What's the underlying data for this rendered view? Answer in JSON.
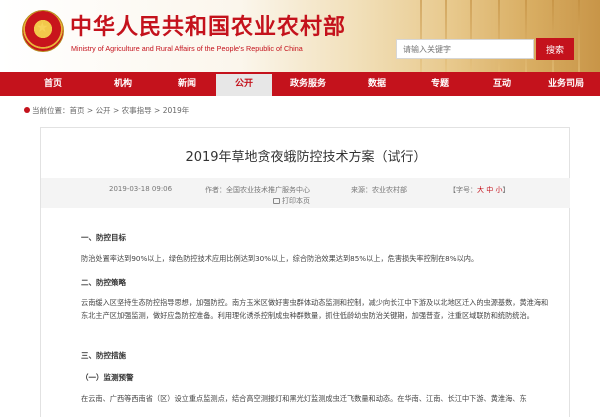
{
  "header": {
    "title": "中华人民共和国农业农村部",
    "subtitle": "Ministry of Agriculture and Rural Affairs of the People's Republic of China",
    "search_placeholder": "请输入关键字",
    "search_button": "搜索"
  },
  "nav": [
    {
      "label": "首页",
      "active": false
    },
    {
      "label": "机构",
      "active": false
    },
    {
      "label": "新闻",
      "active": false
    },
    {
      "label": "公开",
      "active": true
    },
    {
      "label": "政务服务",
      "active": false
    },
    {
      "label": "数据",
      "active": false
    },
    {
      "label": "专题",
      "active": false
    },
    {
      "label": "互动",
      "active": false
    },
    {
      "label": "业务司局",
      "active": false
    }
  ],
  "breadcrumb": {
    "prefix": "当前位置：",
    "items": [
      "首页",
      "公开",
      "农事指导",
      "2019年"
    ]
  },
  "article": {
    "title": "2019年草地贪夜蛾防控技术方案（试行）",
    "date": "2019-03-18 09:06",
    "author": "作者：全国农业技术推广服务中心",
    "source": "来源：农业农村部",
    "font_size_label": "【字号：",
    "font_size_options": [
      "大",
      "中",
      "小"
    ],
    "font_size_close": "】",
    "print_label": "打印本页",
    "sections": {
      "s1_title": "一、防控目标",
      "s1_text": "防治处置率达到90%以上，绿色防控技术应用比例达到30%以上，综合防治效果达到85%以上，危害损失率控制在8%以内。",
      "s2_title": "二、防控策略",
      "s2_text": "云南缓入区坚持生态防控指导思想，加强防控。南方玉米区做好害虫群体动态监测和控制，减少向长江中下游及以北地区迁入的虫源基数，黄淮海和东北主产区加强监测，做好应急防控准备。利用理化诱杀控制成虫种群数量，抓住低龄幼虫防治关键期，加强普查，注重区域联防和统防统治。",
      "s3_title": "三、防控措施",
      "s3_sub1": "（一）监测预警",
      "s3_text": "在云南、广西等西南省（区）设立重点监测点，结合高空测报灯和黑光灯监测成虫迁飞数量和动态。在华南、江南、长江中下游、黄淮海、东"
    }
  }
}
